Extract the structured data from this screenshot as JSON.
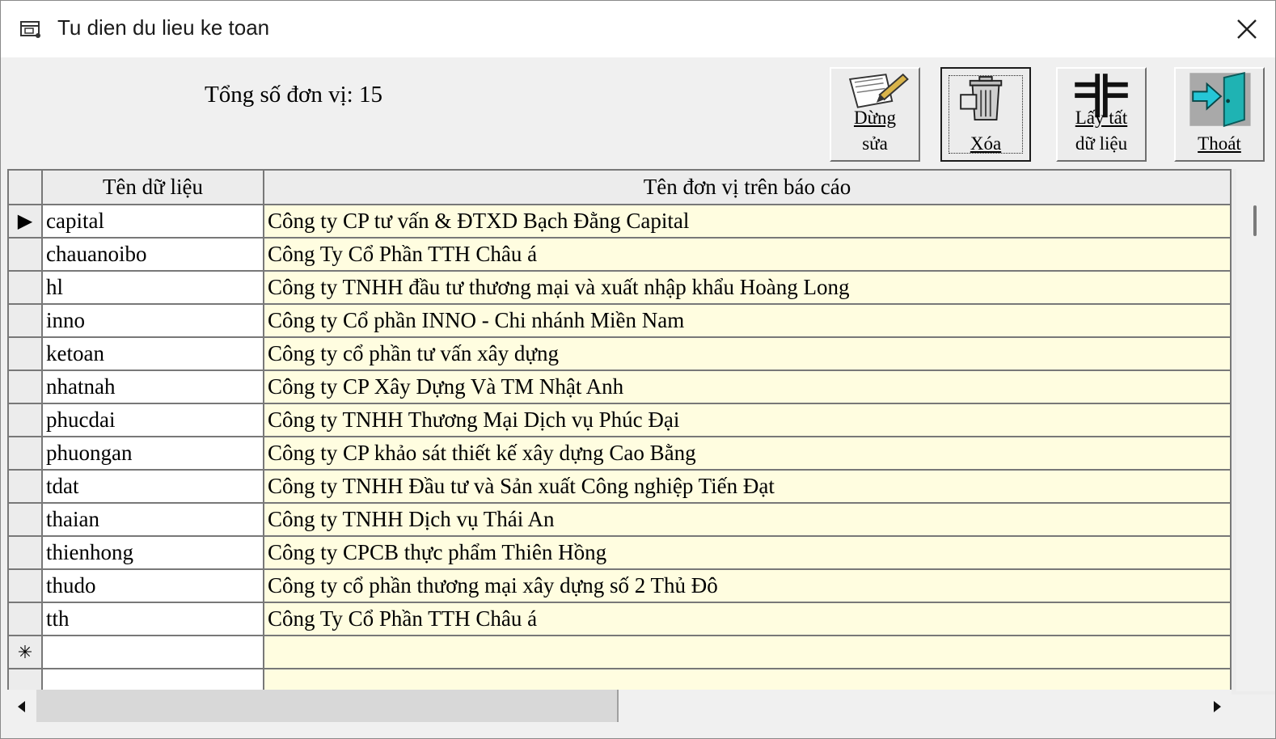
{
  "window": {
    "title": "Tu dien du lieu ke toan",
    "icon": "form-window-icon",
    "close_icon": "close-icon"
  },
  "summary": {
    "total_label": "Tổng số đơn vị: 15"
  },
  "toolbar": {
    "buttons": [
      {
        "name": "edit",
        "icon": "pen-paper-icon",
        "line1": "Dừng",
        "line2": "sửa"
      },
      {
        "name": "delete",
        "icon": "trash-can-icon",
        "line1": "",
        "line2": "Xóa"
      },
      {
        "name": "fetch-all",
        "icon": "split-bars-icon",
        "line1": "Lấy tất",
        "line2": "dữ liệu"
      },
      {
        "name": "exit",
        "icon": "exit-door-icon",
        "line1": "",
        "line2": "Thoát"
      }
    ]
  },
  "grid": {
    "columns": [
      "Tên dữ liệu",
      "Tên đơn vị trên báo cáo"
    ],
    "rows": [
      [
        "capital",
        "Công ty CP tư vấn & ĐTXD Bạch Đằng Capital"
      ],
      [
        "chauanoibo",
        "Công Ty Cổ Phần TTH Châu á"
      ],
      [
        "hl",
        "Công ty TNHH đầu tư thương mại và xuất nhập khẩu Hoàng Long"
      ],
      [
        "inno",
        "Công ty Cổ phần INNO - Chi nhánh Miền Nam"
      ],
      [
        "ketoan",
        "Công ty cổ phần tư vấn xây dựng"
      ],
      [
        "nhatnah",
        "Công ty CP Xây Dựng Và TM Nhật Anh"
      ],
      [
        "phucdai",
        "Công ty TNHH Thương Mại Dịch vụ Phúc Đại"
      ],
      [
        "phuongan",
        "Công ty CP khảo sát thiết kế xây dựng Cao Bằng"
      ],
      [
        "tdat",
        "Công ty TNHH Đầu tư và Sản xuất Công nghiệp Tiến Đạt"
      ],
      [
        "thaian",
        "Công ty TNHH Dịch vụ Thái An"
      ],
      [
        "thienhong",
        "Công ty CPCB thực phẩm Thiên Hồng"
      ],
      [
        "thudo",
        "Công ty cổ phần thương mại xây dựng số 2 Thủ Đô"
      ],
      [
        "tth",
        "Công Ty Cổ Phần TTH Châu á"
      ]
    ],
    "current_row_marker": "▶",
    "new_row_marker": "✳",
    "cell_color": "#fffde0"
  }
}
